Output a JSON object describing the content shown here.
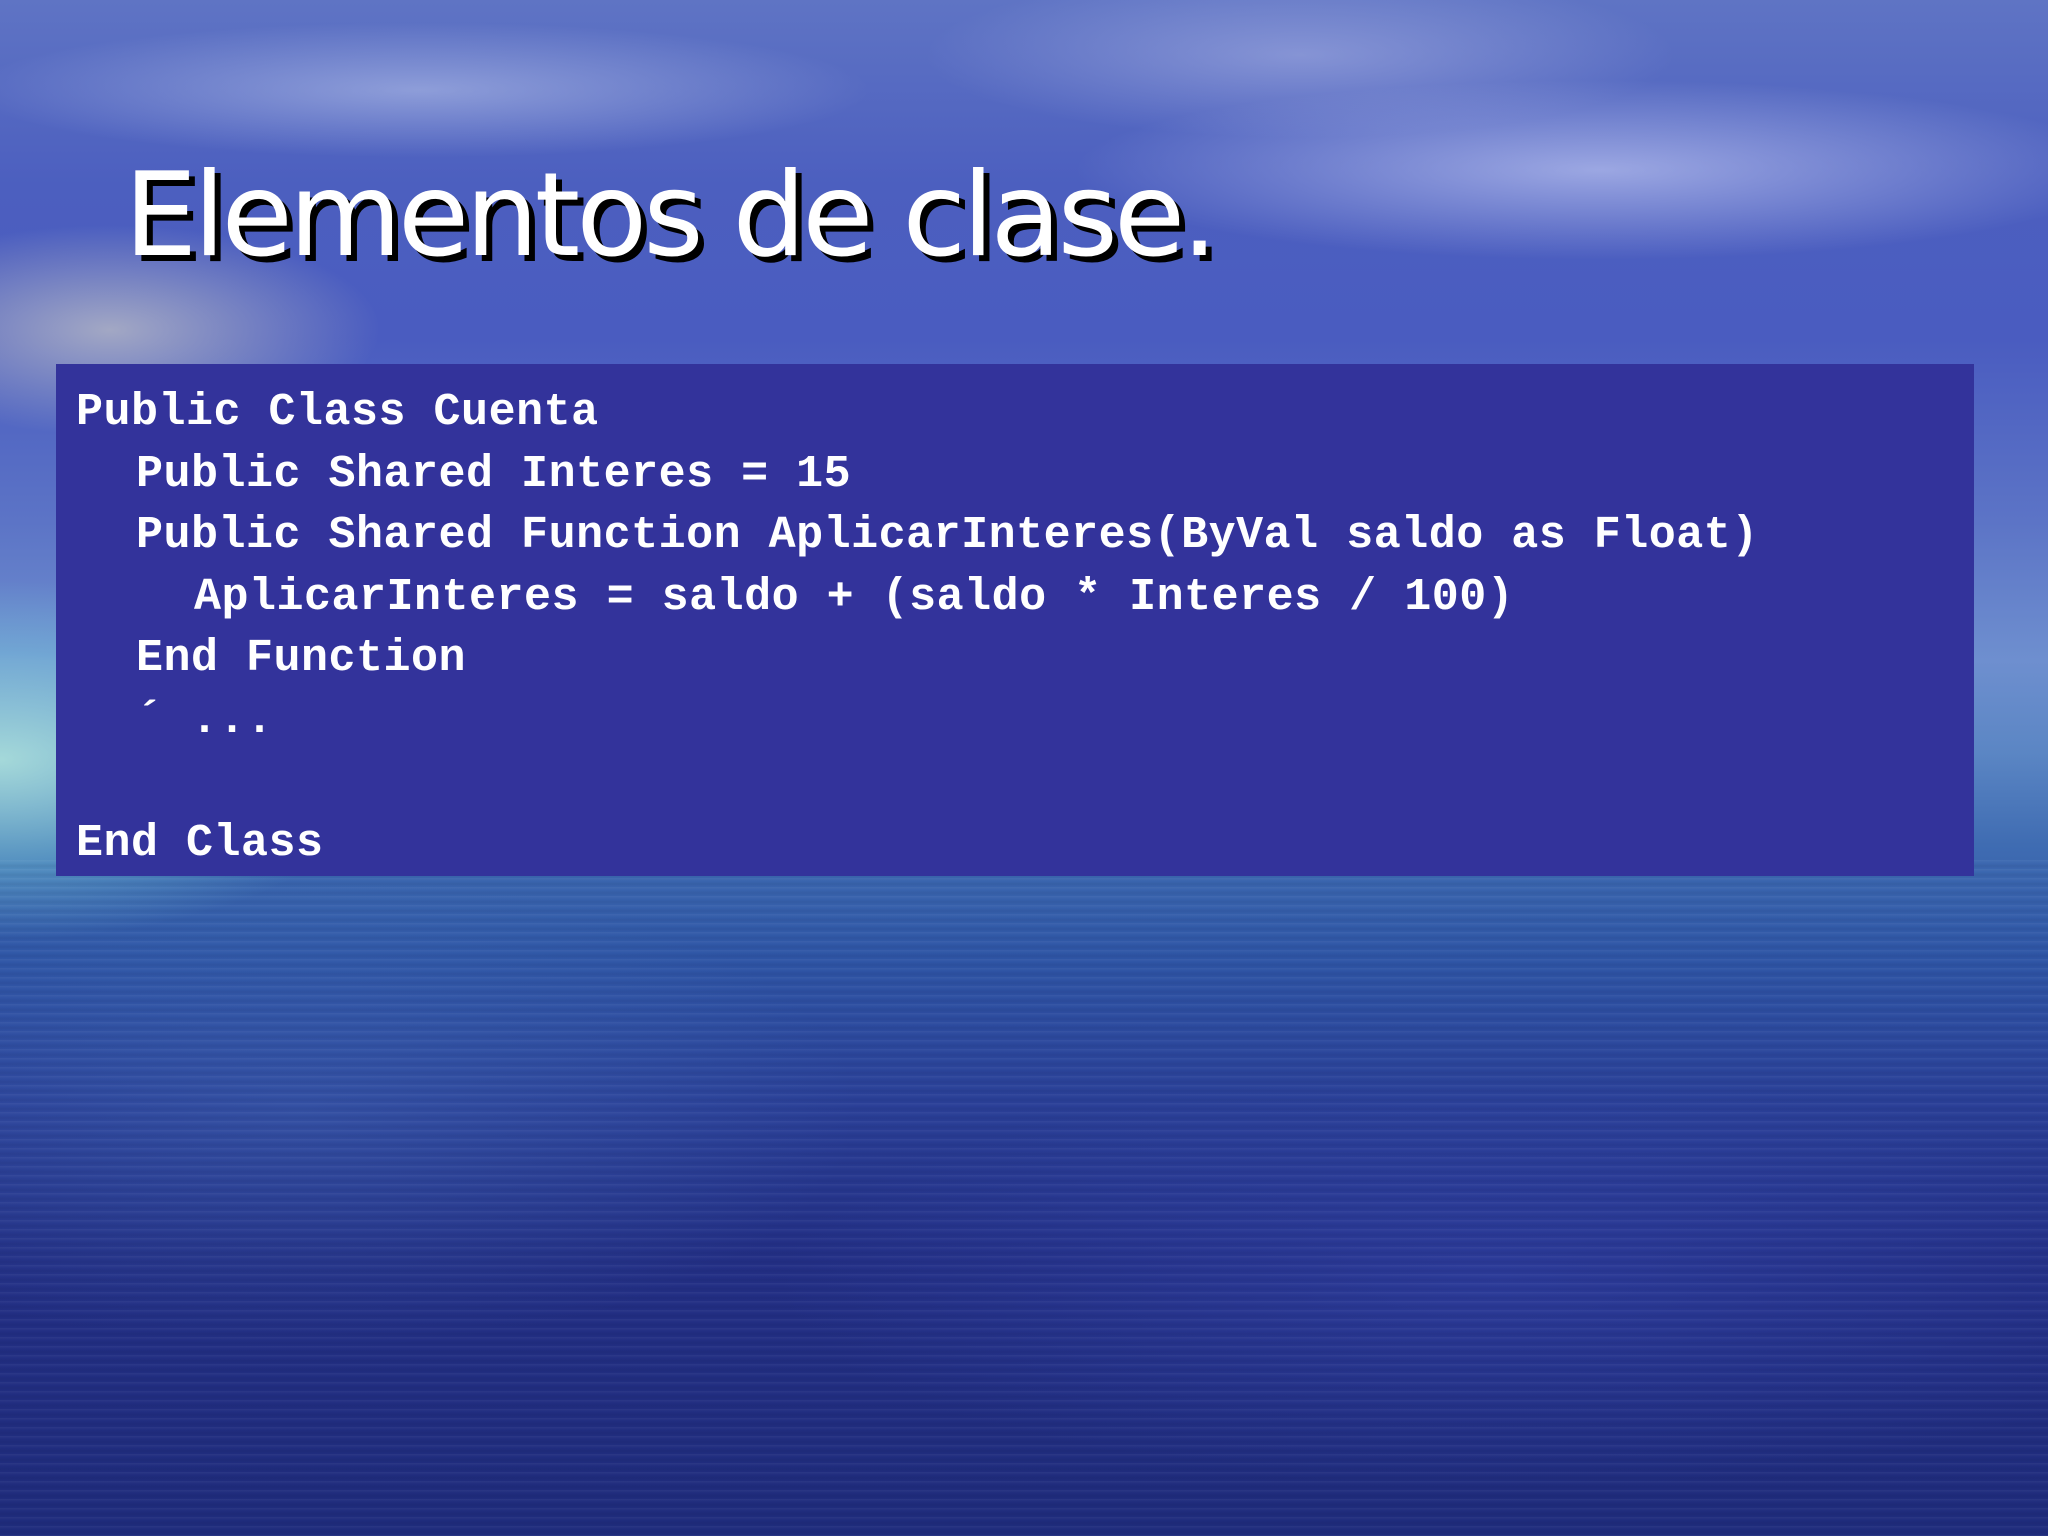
{
  "slide": {
    "title": "Elementos de clase.",
    "code_lines": [
      "Public Class Cuenta",
      "Public Shared Interes = 15",
      "Public Shared Function AplicarInteres(ByVal saldo as Float)",
      "AplicarInteres = saldo + (saldo * Interes / 100)",
      "End Function",
      "´ ...",
      "",
      "End Class"
    ]
  },
  "colors": {
    "code_background": "#33339b",
    "text": "#ffffff",
    "title_shadow": "#000000"
  }
}
